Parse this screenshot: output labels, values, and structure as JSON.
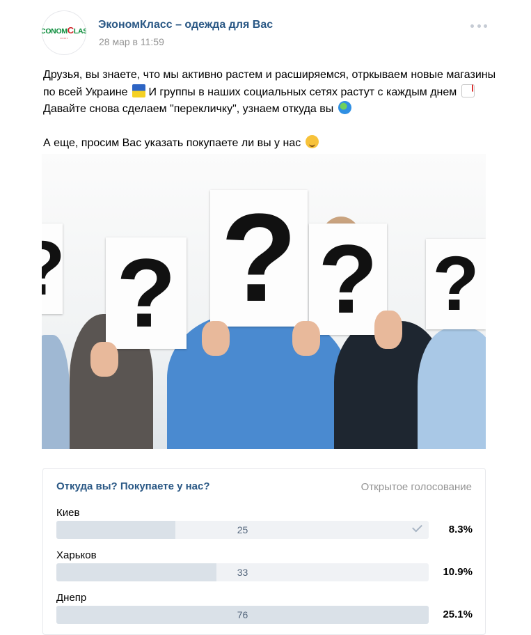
{
  "post": {
    "author": "ЭкономКласс – одежда для Вас",
    "date": "28 мар в 11:59",
    "avatar_logo": "ECONOMCLASS",
    "text_p1_a": "Друзья, вы знаете, что мы активно растем и расширяемся, отркываем новые магазины по всей Украине",
    "text_p1_b": "И группы в наших социальных сетях растут с каждым днем",
    "text_p1_c": "Давайте снова сделаем \"перекличку\", узнаем откуда вы",
    "text_p2": "А еще, просим Вас указать покупаете ли вы у нас",
    "emoji_icons": [
      "ukraine-flag-icon",
      "chart-increasing-icon",
      "globe-icon",
      "winking-face-icon"
    ],
    "photo_signs": [
      "?",
      "?",
      "?",
      "?",
      "?"
    ]
  },
  "poll": {
    "title": "Откуда вы? Покупаете у нас?",
    "type": "Открытое голосование",
    "answers": [
      {
        "label": "Киев",
        "count": "25",
        "percent": "8.3%",
        "fill": 0.32,
        "voted": true
      },
      {
        "label": "Харьков",
        "count": "33",
        "percent": "10.9%",
        "fill": 0.43,
        "voted": false
      },
      {
        "label": "Днепр",
        "count": "76",
        "percent": "25.1%",
        "fill": 1.0,
        "voted": false
      }
    ]
  },
  "colors": {
    "link": "#2a5885",
    "muted": "#939393",
    "bar_track": "#f0f2f5",
    "bar_fill": "#dae1e8"
  }
}
